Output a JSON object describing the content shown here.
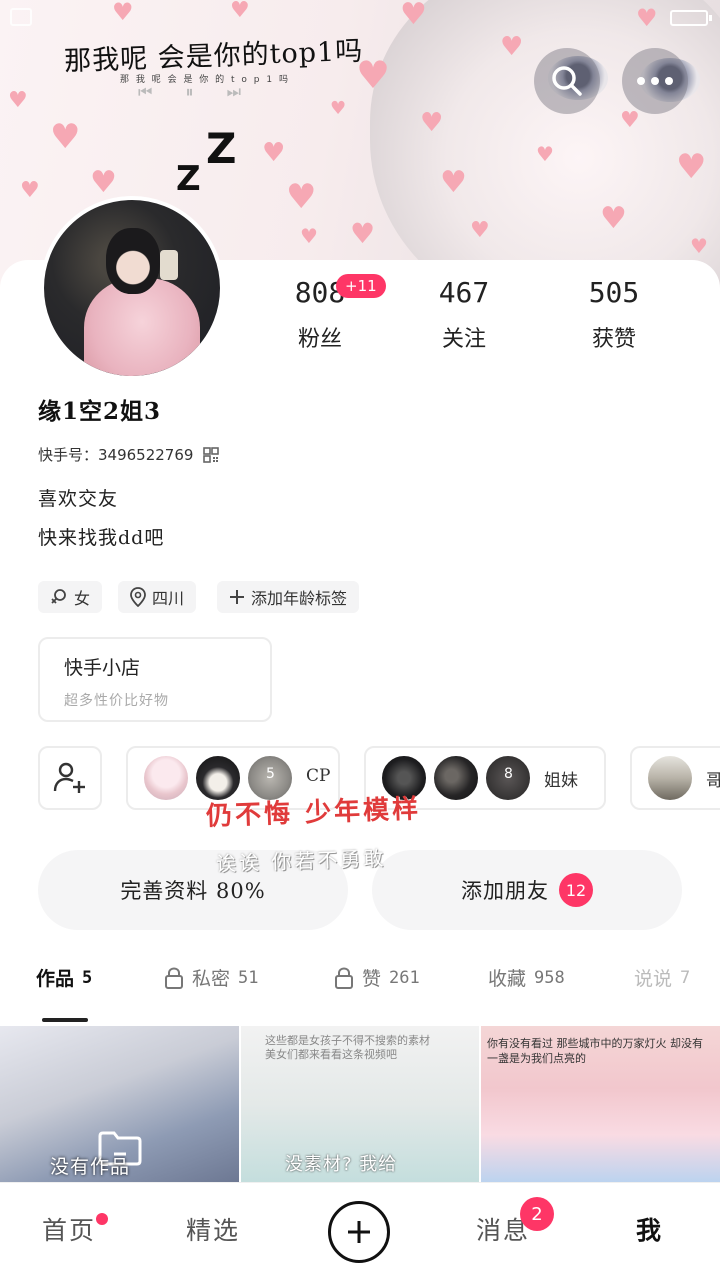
{
  "banner": {
    "lyric_title": "那我呢 会是你的top1吗",
    "lyric_sub": "那 我 呢   会 是 你 的 t o p 1 吗",
    "player_controls": "⏮ ⏸ ⏭",
    "zzz_big": "Z",
    "zzz_small": "Z",
    "search_icon": "search-icon",
    "more_icon": "more-icon"
  },
  "profile": {
    "nickname": "缘1空2姐3",
    "uid_label": "快手号：3496522769",
    "bio_line1": "喜欢交友",
    "bio_line2": "快来找我dd吧"
  },
  "stats": [
    {
      "value": "808",
      "label": "粉丝",
      "badge": "+11"
    },
    {
      "value": "467",
      "label": "关注"
    },
    {
      "value": "505",
      "label": "获赞"
    }
  ],
  "tags": [
    {
      "icon": "female-icon",
      "text": "女"
    },
    {
      "icon": "location-icon",
      "text": "四川"
    },
    {
      "icon": "plus-icon",
      "text": "添加年龄标签"
    }
  ],
  "shop": {
    "title": "快手小店",
    "subtitle": "超多性价比好物"
  },
  "groups": [
    {
      "count": "5",
      "label": "CP"
    },
    {
      "count": "8",
      "label": "姐妹"
    },
    {
      "label": "哥"
    }
  ],
  "overlay": {
    "red_text": "仍不悔 少年模样",
    "white_text": "诶诶 你若不勇敢"
  },
  "actions": {
    "complete_profile": "完善资料 80%",
    "add_friends": "添加朋友",
    "add_friends_badge": "12"
  },
  "tabs": [
    {
      "label": "作品",
      "count": "5",
      "locked": false
    },
    {
      "label": "私密",
      "count": "51",
      "locked": true
    },
    {
      "label": "赞",
      "count": "261",
      "locked": true
    },
    {
      "label": "收藏",
      "count": "958",
      "locked": false
    },
    {
      "label": "说说",
      "count": "7",
      "locked": false
    }
  ],
  "grid": {
    "cell1_text": "没有作品",
    "cell2_small": "这些都是女孩子不得不搜索的素材\n美女们都来看看这条视频吧",
    "cell2_text": "没素材? 我给",
    "cell3_small": "你有没有看过 那些城市中的万家灯火 却没有\n一盏是为我们点亮的"
  },
  "bottom_nav": {
    "home": "首页",
    "featured": "精选",
    "messages": "消息",
    "messages_badge": "2",
    "me": "我"
  },
  "colors": {
    "accent": "#fe3666",
    "heart": "#f6a8b4",
    "red_overlay": "#e03b3b"
  }
}
